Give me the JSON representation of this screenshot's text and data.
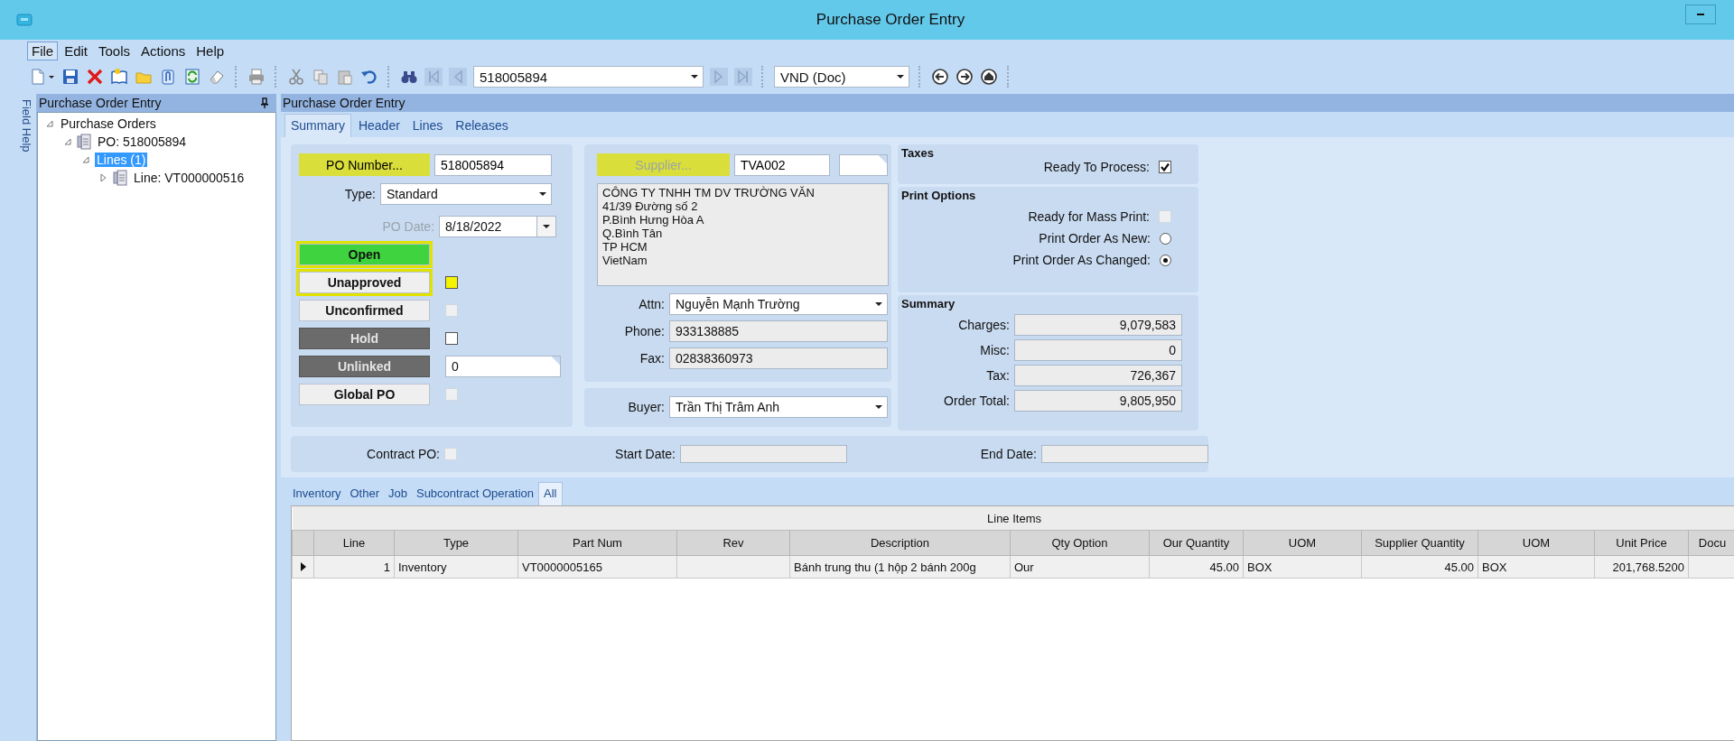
{
  "window": {
    "title": "Purchase Order Entry"
  },
  "menu": [
    {
      "label": "File",
      "selected": true
    },
    {
      "label": "Edit",
      "selected": false
    },
    {
      "label": "Tools",
      "selected": false
    },
    {
      "label": "Actions",
      "selected": false
    },
    {
      "label": "Help",
      "selected": false
    }
  ],
  "toolbar": {
    "record": "518005894",
    "currency": "VND (Doc)"
  },
  "field_help": {
    "label": "Field Help"
  },
  "tree_panel": {
    "title": "Purchase Order Entry",
    "items": [
      {
        "label": "Purchase Orders",
        "icon": false,
        "expanded": true,
        "selected": false,
        "children": [
          {
            "label": "PO: 518005894",
            "icon": true,
            "expanded": true,
            "selected": false,
            "children": [
              {
                "label": "Lines (1)",
                "icon": false,
                "expanded": true,
                "selected": true,
                "children": [
                  {
                    "label": "Line: VT000000516",
                    "icon": true,
                    "expanded": false,
                    "selected": false
                  }
                ]
              }
            ]
          }
        ]
      }
    ]
  },
  "content_panel": {
    "title": "Purchase Order Entry"
  },
  "tabs": [
    {
      "label": "Summary",
      "selected": true
    },
    {
      "label": "Header",
      "selected": false
    },
    {
      "label": "Lines",
      "selected": false
    },
    {
      "label": "Releases",
      "selected": false
    }
  ],
  "order": {
    "po_number": {
      "label": "PO Number...",
      "value": "518005894",
      "highlighted": true
    },
    "type": {
      "label": "Type:",
      "value": "Standard"
    },
    "po_date": {
      "label": "PO Date:",
      "value": "8/18/2022",
      "disabled": true
    },
    "statuses": [
      {
        "label": "Open",
        "kind": "none",
        "color": "#3fd43f",
        "highlighted": true
      },
      {
        "label": "Unapproved",
        "kind": "checkbox",
        "color": "#efefef",
        "highlighted": true,
        "checked": false,
        "disabled": false
      },
      {
        "label": "Unconfirmed",
        "kind": "checkbox",
        "color": "#efefef",
        "highlighted": false,
        "checked": false,
        "disabled": true
      },
      {
        "label": "Hold",
        "kind": "checkbox",
        "color": "#6b6b6b",
        "highlighted": false,
        "checked": false,
        "disabled": false
      },
      {
        "label": "Unlinked",
        "kind": "field",
        "color": "#6b6b6b",
        "highlighted": false,
        "value": "0"
      },
      {
        "label": "Global PO",
        "kind": "checkbox",
        "color": "#efefef",
        "highlighted": false,
        "checked": false,
        "disabled": true
      }
    ]
  },
  "supplier": {
    "label": "Supplier...",
    "disabled": true,
    "highlighted": true,
    "id": "TVA002",
    "address": [
      "CÔNG TY TNHH TM DV TRƯỜNG VĂN",
      "41/39 Đường số 2",
      "P.Bình Hưng Hòa A",
      "Q.Bình Tân",
      "TP HCM",
      "VietNam"
    ],
    "attn": {
      "label": "Attn:",
      "value": "Nguyễn Mạnh Trường"
    },
    "phone": {
      "label": "Phone:",
      "value": "933138885"
    },
    "fax": {
      "label": "Fax:",
      "value": "02838360973"
    }
  },
  "buyer": {
    "label": "Buyer:",
    "value": "Trần Thị Trâm Anh"
  },
  "taxes": {
    "title": "Taxes",
    "label": "Ready To Process:",
    "checked": true
  },
  "print_options": {
    "title": "Print Options",
    "options": [
      {
        "label": "Ready for Mass Print:",
        "kind": "checkbox",
        "checked": false,
        "disabled": true
      },
      {
        "label": "Print Order As New:",
        "kind": "radio",
        "selected": false
      },
      {
        "label": "Print Order As Changed:",
        "kind": "radio",
        "selected": true
      }
    ]
  },
  "summary": {
    "title": "Summary",
    "rows": [
      {
        "label": "Charges:",
        "value": "9,079,583"
      },
      {
        "label": "Misc:",
        "value": "0"
      },
      {
        "label": "Tax:",
        "value": "726,367"
      },
      {
        "label": "Order Total:",
        "value": "9,805,950"
      }
    ]
  },
  "contract": {
    "contract_po": {
      "label": "Contract PO:",
      "checked": false,
      "disabled": true
    },
    "start_date": {
      "label": "Start Date:"
    },
    "end_date": {
      "label": "End Date:"
    }
  },
  "line_tabs": [
    {
      "label": "Inventory",
      "selected": false
    },
    {
      "label": "Other",
      "selected": false
    },
    {
      "label": "Job",
      "selected": false
    },
    {
      "label": "Subcontract Operation",
      "selected": false
    },
    {
      "label": "All",
      "selected": true
    }
  ],
  "line_items": {
    "title": "Line Items",
    "columns": [
      {
        "label": "Line",
        "kind": "number"
      },
      {
        "label": "Type",
        "kind": "text"
      },
      {
        "label": "Part Num",
        "kind": "text"
      },
      {
        "label": "Rev",
        "kind": "text"
      },
      {
        "label": "Description",
        "kind": "text"
      },
      {
        "label": "Qty Option",
        "kind": "text"
      },
      {
        "label": "Our Quantity",
        "kind": "number"
      },
      {
        "label": "UOM",
        "kind": "text"
      },
      {
        "label": "Supplier Quantity",
        "kind": "number"
      },
      {
        "label": "UOM",
        "kind": "text"
      },
      {
        "label": "Unit Price",
        "kind": "number"
      },
      {
        "label": "Docu",
        "kind": "text"
      }
    ],
    "rows": [
      {
        "current": true,
        "cells": [
          "1",
          "Inventory",
          "VT0000005165",
          "",
          "Bánh trung thu (1 hộp 2 bánh 200g",
          "Our",
          "45.00",
          "BOX",
          "45.00",
          "BOX",
          "201,768.5200",
          ""
        ]
      }
    ]
  }
}
